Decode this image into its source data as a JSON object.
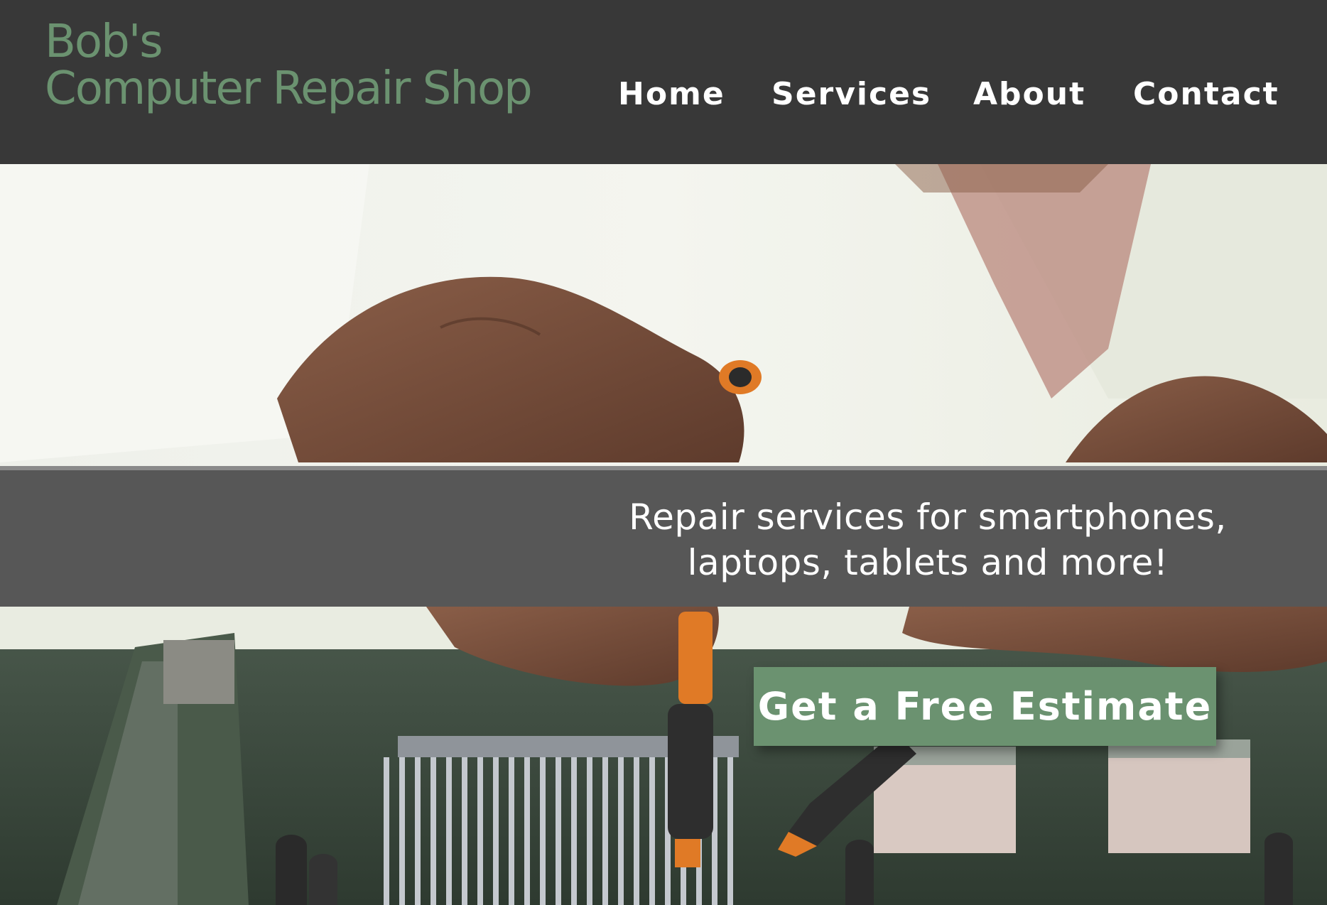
{
  "header": {
    "logo_line1": "Bob's",
    "logo_line2": "Computer Repair Shop",
    "nav": {
      "home": "Home",
      "services": "Services",
      "about": "About",
      "contact": "Contact"
    }
  },
  "hero": {
    "tagline_line1": "Repair services for smartphones,",
    "tagline_line2": "laptops, tablets and more!",
    "cta_label": "Get a Free Estimate"
  },
  "colors": {
    "header_bg": "#383838",
    "brand_green": "#6b9270",
    "band_bg": "#575757",
    "nav_text": "#ffffff"
  }
}
